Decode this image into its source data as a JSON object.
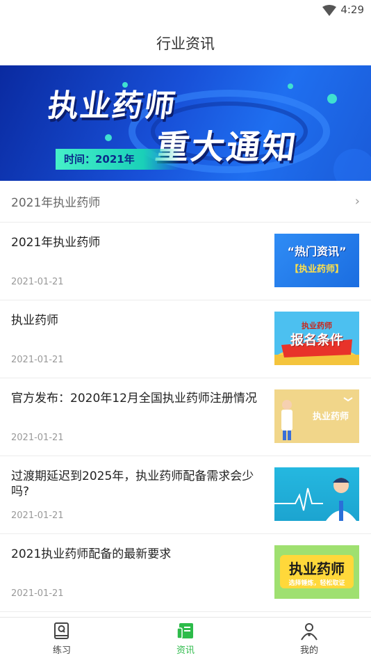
{
  "status_bar": {
    "time": "4:29"
  },
  "header": {
    "title": "行业资讯"
  },
  "banner": {
    "line1": "执业药师",
    "line2": "重大通知",
    "time_label": "时间：2021年"
  },
  "section": {
    "title": "2021年执业药师"
  },
  "news": [
    {
      "title": "2021年执业药师",
      "date": "2021-01-21",
      "thumb_line1": "“热门资讯”",
      "thumb_line2": "【执业药师】"
    },
    {
      "title": "执业药师",
      "date": "2021-01-21",
      "thumb_line1": "执业药师",
      "thumb_line2": "报名条件"
    },
    {
      "title": "官方发布：2020年12月全国执业药师注册情况",
      "date": "2021-01-21",
      "thumb_line1": "执业药师"
    },
    {
      "title": "过渡期延迟到2025年，执业药师配备需求会少吗?",
      "date": "2021-01-21"
    },
    {
      "title": "2021执业药师配备的最新要求",
      "date": "2021-01-21",
      "thumb_line1": "执业药师",
      "thumb_line2": "选择锤炼，轻松取证"
    }
  ],
  "tabs": [
    {
      "label": "练习",
      "icon": "practice-book-icon"
    },
    {
      "label": "资讯",
      "icon": "news-icon",
      "active": true
    },
    {
      "label": "我的",
      "icon": "profile-icon"
    }
  ],
  "colors": {
    "accent": "#2dbb4a",
    "banner_blue": "#1850d8"
  }
}
